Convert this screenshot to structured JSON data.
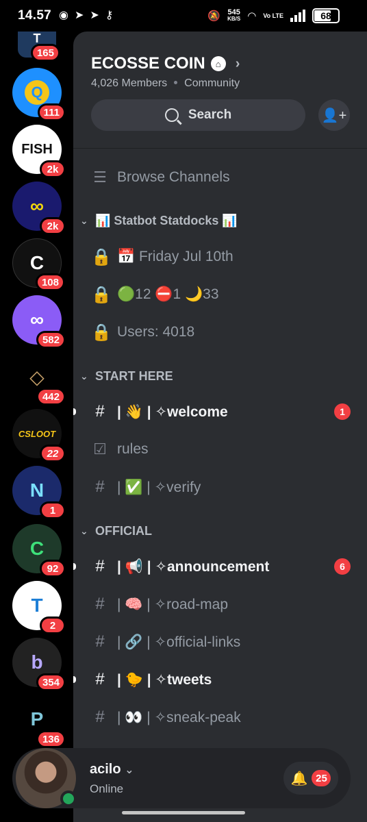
{
  "status_bar": {
    "time": "14.57",
    "speed_value": "545",
    "speed_unit": "KB/S",
    "network": "Vo LTE",
    "battery": "68"
  },
  "servers": [
    {
      "icon": "T",
      "badge": "165",
      "color": "#1f3a5f"
    },
    {
      "icon": "Q",
      "badge": "111",
      "color": "#1e90ff"
    },
    {
      "icon": "FISH",
      "badge": "2k",
      "color": "#ffffff"
    },
    {
      "icon": "∞",
      "badge": "2k",
      "color": "#1a1a6e"
    },
    {
      "icon": "C",
      "badge": "108",
      "color": "#111111"
    },
    {
      "icon": "∞",
      "badge": "582",
      "color": "#8b5cf6"
    },
    {
      "icon": "◇",
      "badge": "442",
      "color": "#6b5233"
    },
    {
      "icon": "CSLOOT",
      "badge": "22",
      "color": "#111111"
    },
    {
      "icon": "N",
      "badge": "1",
      "color": "#1b2a6b"
    },
    {
      "icon": "C",
      "badge": "92",
      "color": "#1e3a2a"
    },
    {
      "icon": "T",
      "badge": "2",
      "color": "#ffffff"
    },
    {
      "icon": "b",
      "badge": "354",
      "color": "#222222"
    },
    {
      "icon": "P",
      "badge": "136",
      "color": "#000000"
    }
  ],
  "guild": {
    "name": "ECOSSE COIN",
    "members": "4,026 Members",
    "type": "Community",
    "search_label": "Search"
  },
  "browse_channels": "Browse Channels",
  "categories": {
    "statbot": "📊 Statbot Statdocks 📊",
    "start_here": "START HERE",
    "official": "OFFICIAL"
  },
  "stat_channels": [
    {
      "label": "📅 Friday Jul 10th"
    },
    {
      "label": "🟢12 ⛔1 🌙33"
    },
    {
      "label": "Users: 4018"
    }
  ],
  "start_channels": [
    {
      "label": "| 👋 | ✧welcome",
      "unread": true,
      "count": "1"
    },
    {
      "label": "rules",
      "unread": false
    },
    {
      "label": "| ✅ | ✧verify",
      "unread": false
    }
  ],
  "official_channels": [
    {
      "label": "| 📢 | ✧announcement",
      "unread": true,
      "count": "6"
    },
    {
      "label": "| 🧠 | ✧road-map",
      "unread": false
    },
    {
      "label": "| 🔗 | ✧official-links",
      "unread": false
    },
    {
      "label": "| 🐤 | ✧tweets",
      "unread": true
    },
    {
      "label": "| 👀 | ✧sneak-peak",
      "unread": false
    }
  ],
  "user": {
    "name": "acilo",
    "status": "Online",
    "notifications": "25"
  }
}
